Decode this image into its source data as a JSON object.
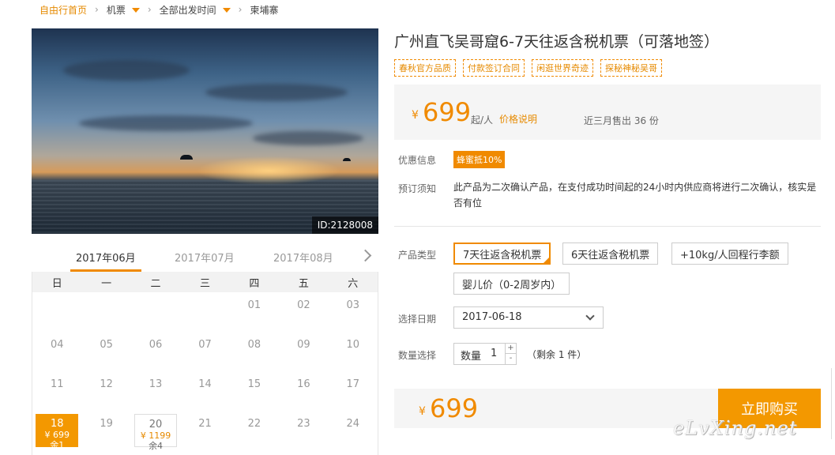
{
  "breadcrumb": {
    "home": "自由行首页",
    "flights": "机票",
    "departure": "全部出发时间",
    "destination": "柬埔寨"
  },
  "hero": {
    "id_tag": "ID:2128008"
  },
  "calendar": {
    "months": [
      "2017年06月",
      "2017年07月",
      "2017年08月"
    ],
    "weekdays": [
      "日",
      "一",
      "二",
      "三",
      "四",
      "五",
      "六"
    ],
    "days": [
      {
        "d": ""
      },
      {
        "d": ""
      },
      {
        "d": ""
      },
      {
        "d": ""
      },
      {
        "d": "01"
      },
      {
        "d": "02"
      },
      {
        "d": "03"
      },
      {
        "d": "04"
      },
      {
        "d": "05"
      },
      {
        "d": "06"
      },
      {
        "d": "07"
      },
      {
        "d": "08"
      },
      {
        "d": "09"
      },
      {
        "d": "10"
      },
      {
        "d": "11"
      },
      {
        "d": "12"
      },
      {
        "d": "13"
      },
      {
        "d": "14"
      },
      {
        "d": "15"
      },
      {
        "d": "16"
      },
      {
        "d": "17"
      },
      {
        "d": "18",
        "price": "¥ 699",
        "remain": "余1",
        "state": "selected"
      },
      {
        "d": "19"
      },
      {
        "d": "20",
        "price": "¥ 1199",
        "remain": "余4",
        "state": "available"
      },
      {
        "d": "21"
      },
      {
        "d": "22"
      },
      {
        "d": "23"
      },
      {
        "d": "24"
      }
    ]
  },
  "product": {
    "title": "广州直飞吴哥窟6-7天往返含税机票（可落地签）",
    "tags": [
      "春秋官方品质",
      "付款签订合同",
      "闲逛世界奇迹",
      "探秘神秘吴哥"
    ],
    "currency": "¥",
    "price": "699",
    "price_unit": "起/人",
    "price_note": "价格说明",
    "sold": "近三月售出 36 份"
  },
  "labels": {
    "promo": "优惠信息",
    "notice": "预订须知",
    "type": "产品类型",
    "date": "选择日期",
    "qty": "数量选择"
  },
  "promo_badge": "蜂蜜抵10%",
  "notice_text": "此产品为二次确认产品，在支付成功时间起的24小时内供应商将进行二次确认，核实是否有位",
  "options": [
    "7天往返含税机票",
    "6天往返含税机票",
    "+10kg/人回程行李额",
    "婴儿价（0-2周岁内）"
  ],
  "date_value": "2017-06-18",
  "quantity": {
    "label": "数量",
    "value": "1",
    "plus": "+",
    "minus": "-",
    "remain": "（剩余 1 件）"
  },
  "total": {
    "currency": "¥",
    "amount": "699"
  },
  "buy_button": "立即购买",
  "watermark": "eLvXing.net"
}
